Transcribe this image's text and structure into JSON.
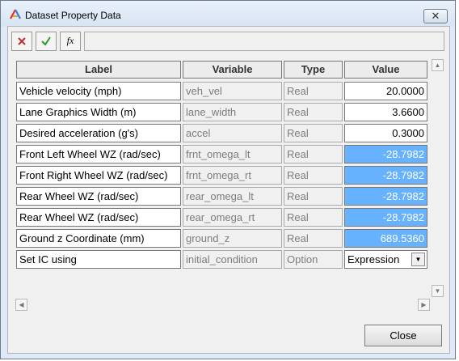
{
  "window": {
    "title": "Dataset Property Data"
  },
  "toolbar": {
    "reject_icon": "x-mark-icon",
    "accept_icon": "check-mark-icon",
    "function_icon": "function-icon",
    "function_label": "fx",
    "formula_value": ""
  },
  "table": {
    "headers": [
      "Label",
      "Variable",
      "Type",
      "Value"
    ],
    "rows": [
      {
        "label": "Vehicle velocity (mph)",
        "variable": "veh_vel",
        "type": "Real",
        "value": "20.0000",
        "selected": false
      },
      {
        "label": "Lane Graphics Width (m)",
        "variable": "lane_width",
        "type": "Real",
        "value": "3.6600",
        "selected": false
      },
      {
        "label": "Desired acceleration (g's)",
        "variable": "accel",
        "type": "Real",
        "value": "0.3000",
        "selected": false
      },
      {
        "label": "Front Left Wheel WZ (rad/sec)",
        "variable": "frnt_omega_lt",
        "type": "Real",
        "value": "-28.7982",
        "selected": true
      },
      {
        "label": "Front Right Wheel WZ (rad/sec)",
        "variable": "frnt_omega_rt",
        "type": "Real",
        "value": "-28.7982",
        "selected": true
      },
      {
        "label": "Rear Wheel WZ (rad/sec)",
        "variable": "rear_omega_lt",
        "type": "Real",
        "value": "-28.7982",
        "selected": true
      },
      {
        "label": "Rear Wheel WZ (rad/sec)",
        "variable": "rear_omega_rt",
        "type": "Real",
        "value": "-28.7982",
        "selected": true
      },
      {
        "label": "Ground z Coordinate (mm)",
        "variable": "ground_z",
        "type": "Real",
        "value": "689.5360",
        "selected": true
      },
      {
        "label": "Set IC using",
        "variable": "initial_condition",
        "type": "Option",
        "value": "Expression",
        "selected": false
      }
    ]
  },
  "buttons": {
    "close": "Close"
  },
  "colors": {
    "selection": "#66b2ff",
    "window_frame": "#dfeaf6"
  }
}
